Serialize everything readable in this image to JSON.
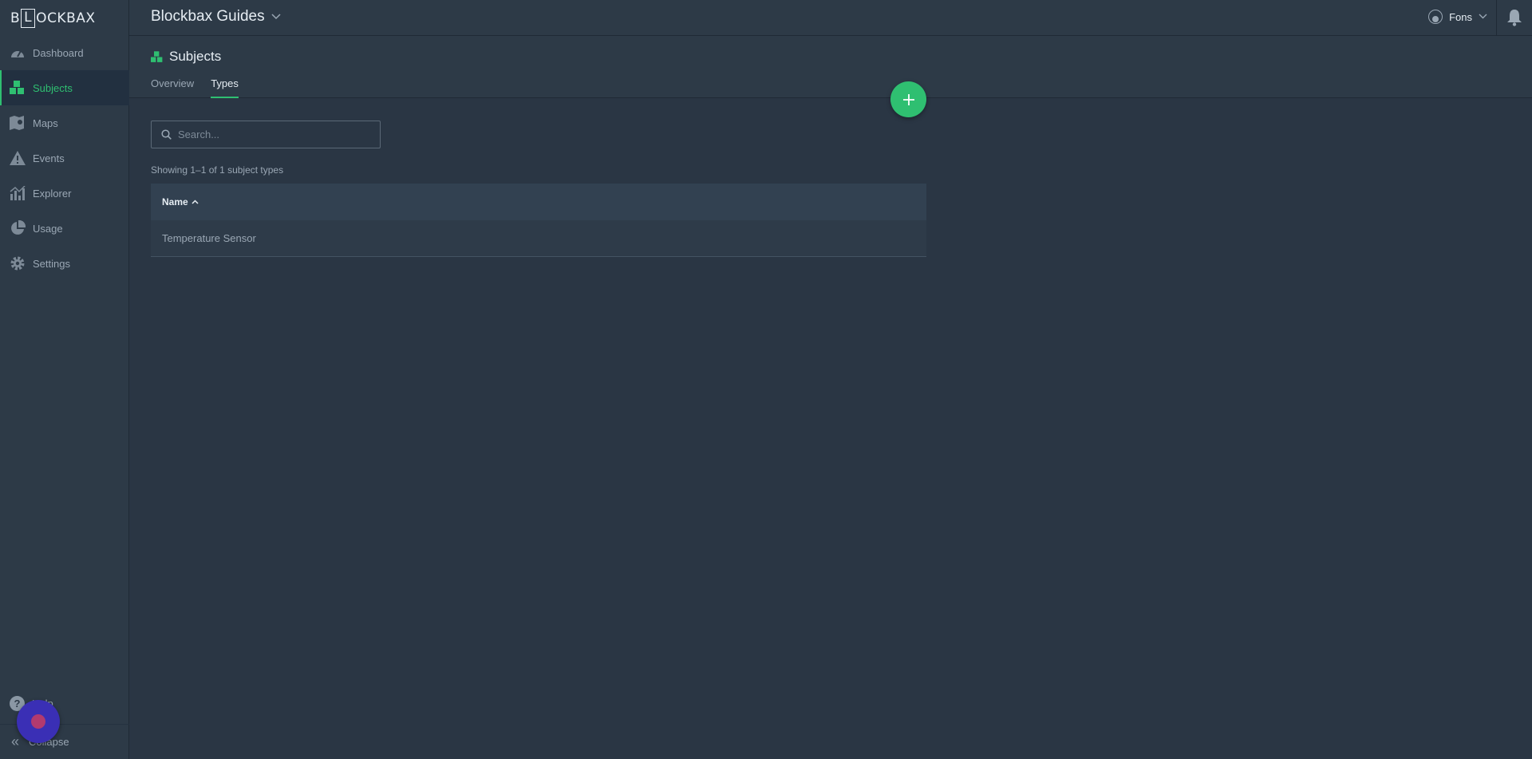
{
  "brand": {
    "logo_pre": "B",
    "logo_box1": "L",
    "logo_box2": "O",
    "logo_post": "CKBAX"
  },
  "colors": {
    "accent": "#2fbf71",
    "sidebar_bg": "#2d3a47",
    "content_bg": "#2a3644"
  },
  "sidebar": {
    "items": [
      {
        "label": "Dashboard",
        "icon": "gauge-icon",
        "active": false
      },
      {
        "label": "Subjects",
        "icon": "subjects-icon",
        "active": true
      },
      {
        "label": "Maps",
        "icon": "map-icon",
        "active": false
      },
      {
        "label": "Events",
        "icon": "warning-icon",
        "active": false
      },
      {
        "label": "Explorer",
        "icon": "chart-icon",
        "active": false
      },
      {
        "label": "Usage",
        "icon": "pie-icon",
        "active": false
      },
      {
        "label": "Settings",
        "icon": "gear-icon",
        "active": false
      }
    ],
    "help_label": "Help",
    "collapse_label": "Collapse"
  },
  "header": {
    "org_title": "Blockbax Guides",
    "user_name": "Fons"
  },
  "page": {
    "title": "Subjects",
    "tabs": [
      {
        "label": "Overview",
        "active": false
      },
      {
        "label": "Types",
        "active": true
      }
    ]
  },
  "search": {
    "placeholder": "Search..."
  },
  "list": {
    "count_text": "Showing 1–1 of 1 subject types",
    "columns": [
      {
        "label": "Name",
        "sort": "asc"
      }
    ],
    "rows": [
      {
        "name": "Temperature Sensor"
      }
    ]
  }
}
